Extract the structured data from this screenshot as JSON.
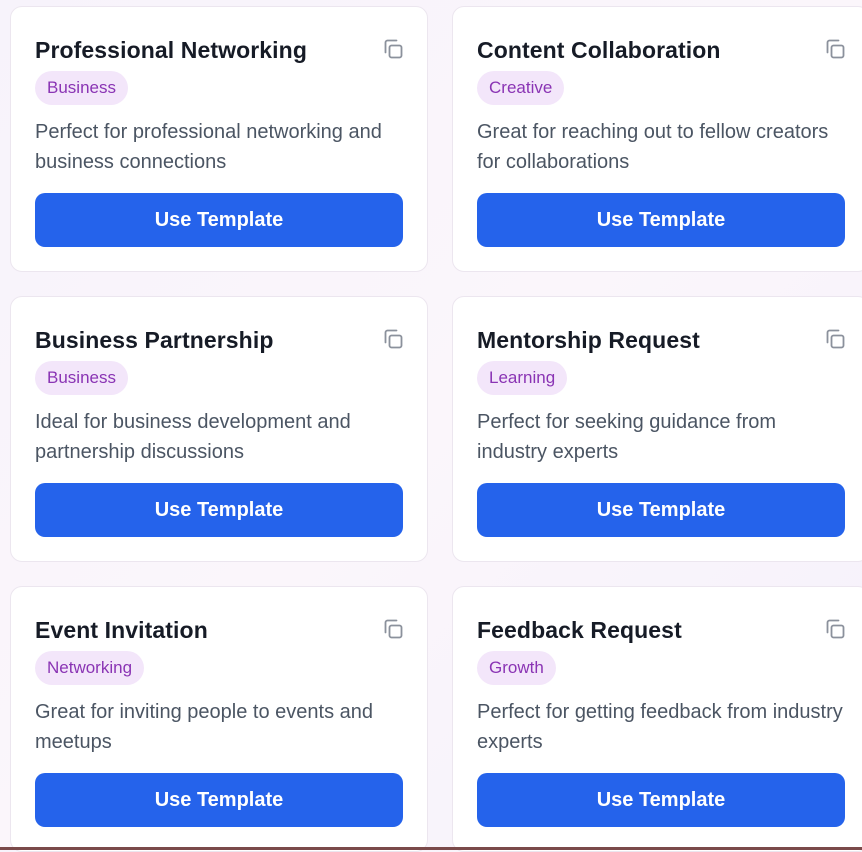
{
  "colors": {
    "accent": "#2563eb",
    "badge_bg": "#f3e6fa",
    "badge_text": "#8a34b4",
    "title_text": "#161b26",
    "desc_text": "#4b5563"
  },
  "icons": {
    "copy": "copy-icon"
  },
  "templates": [
    {
      "title": "Professional Networking",
      "category": "Business",
      "description": "Perfect for professional networking and business connections",
      "button_label": "Use Template"
    },
    {
      "title": "Content Collaboration",
      "category": "Creative",
      "description": "Great for reaching out to fellow creators for collaborations",
      "button_label": "Use Template"
    },
    {
      "title": "Business Partnership",
      "category": "Business",
      "description": "Ideal for business development and partnership discussions",
      "button_label": "Use Template"
    },
    {
      "title": "Mentorship Request",
      "category": "Learning",
      "description": "Perfect for seeking guidance from industry experts",
      "button_label": "Use Template"
    },
    {
      "title": "Event Invitation",
      "category": "Networking",
      "description": "Great for inviting people to events and meetups",
      "button_label": "Use Template"
    },
    {
      "title": "Feedback Request",
      "category": "Growth",
      "description": "Perfect for getting feedback from industry experts",
      "button_label": "Use Template"
    }
  ]
}
